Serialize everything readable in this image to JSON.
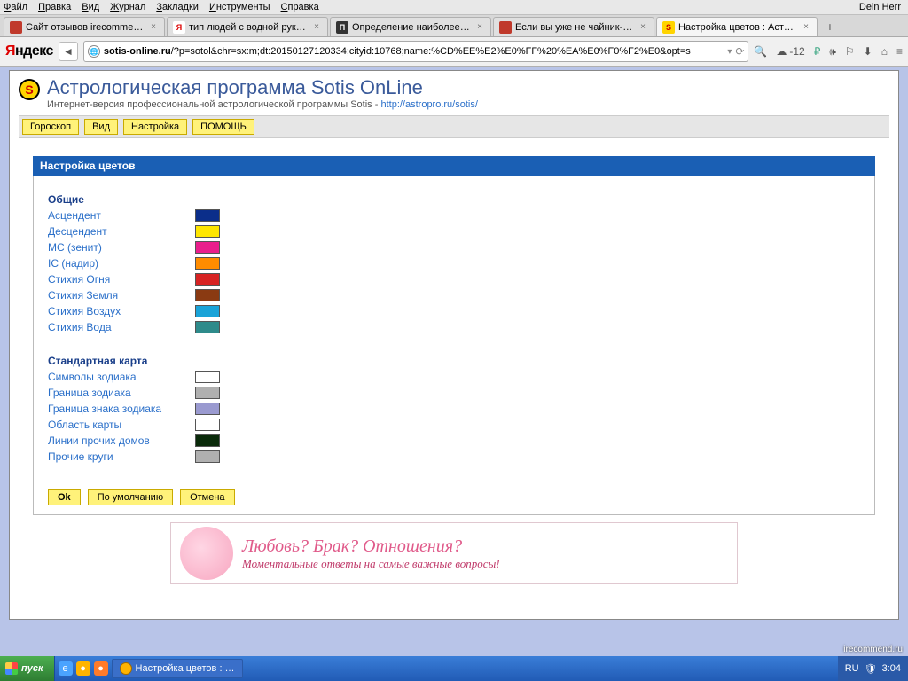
{
  "browser": {
    "menus": [
      "Файл",
      "Правка",
      "Вид",
      "Журнал",
      "Закладки",
      "Инструменты",
      "Справка"
    ],
    "user": "Dein Herr",
    "tabs": [
      {
        "title": "Сайт отзывов irecommend.r…",
        "favColor": "#c0392b",
        "favText": ""
      },
      {
        "title": "тип людей с водной рукой …",
        "favColor": "#fff",
        "favText": "Я",
        "favTextColor": "#d00"
      },
      {
        "title": "Определение наиболее под…",
        "favColor": "#333",
        "favText": "П",
        "favTextColor": "#fff"
      },
      {
        "title": "Если вы уже не чайник-аст…",
        "favColor": "#c0392b",
        "favText": ""
      },
      {
        "title": "Настройка цветов : Астрол…",
        "favColor": "#ffd400",
        "favText": "S",
        "favTextColor": "#c00",
        "active": true
      }
    ],
    "brand": "Яндекс",
    "url_host": "sotis-online.ru",
    "url_path": "/?p=sotol&chr=sx:m;dt:20150127120334;cityid:10768;name:%CD%EE%E2%E0%FF%20%EA%E0%F0%F2%E0&opt=s",
    "weather_temp": "-12"
  },
  "page": {
    "title": "Астрологическая программа Sotis OnLine",
    "subtitle_prefix": "Интернет-версия профессиональной астрологической программы Sotis - ",
    "subtitle_link": "http://astropro.ru/sotis/",
    "menu": [
      "Гороскоп",
      "Вид",
      "Настройка",
      "ПОМОЩЬ"
    ],
    "panel_title": "Настройка цветов",
    "sections": [
      {
        "heading": "Общие",
        "rows": [
          {
            "label": "Асцендент",
            "color": "#0b2e8a"
          },
          {
            "label": "Десцендент",
            "color": "#ffe600"
          },
          {
            "label": "MC (зенит)",
            "color": "#e91e8c"
          },
          {
            "label": "IC (надир)",
            "color": "#ff8c00"
          },
          {
            "label": "Стихия Огня",
            "color": "#d72323"
          },
          {
            "label": "Стихия Земля",
            "color": "#8a3a12"
          },
          {
            "label": "Стихия Воздух",
            "color": "#1aa3d8"
          },
          {
            "label": "Стихия Вода",
            "color": "#2e8b8b"
          }
        ]
      },
      {
        "heading": "Стандартная карта",
        "rows": [
          {
            "label": "Символы зодиака",
            "color": "#ffffff"
          },
          {
            "label": "Граница зодиака",
            "color": "#b0b0b0"
          },
          {
            "label": "Граница знака зодиака",
            "color": "#9a9ad0"
          },
          {
            "label": "Область карты",
            "color": "#ffffff"
          },
          {
            "label": "Линии прочих домов",
            "color": "#0a2a0a"
          },
          {
            "label": "Прочие круги",
            "color": "#b0b0b0"
          }
        ]
      }
    ],
    "buttons": {
      "ok": "Ok",
      "default": "По умолчанию",
      "cancel": "Отмена"
    }
  },
  "banner": {
    "line1": "Любовь? Брак? Отношения?",
    "line2": "Моментальные ответы на самые важные вопросы!"
  },
  "taskbar": {
    "start": "пуск",
    "active_task": "Настройка цветов : …",
    "clock": "3:04",
    "watermark": "irecommend.ru"
  }
}
